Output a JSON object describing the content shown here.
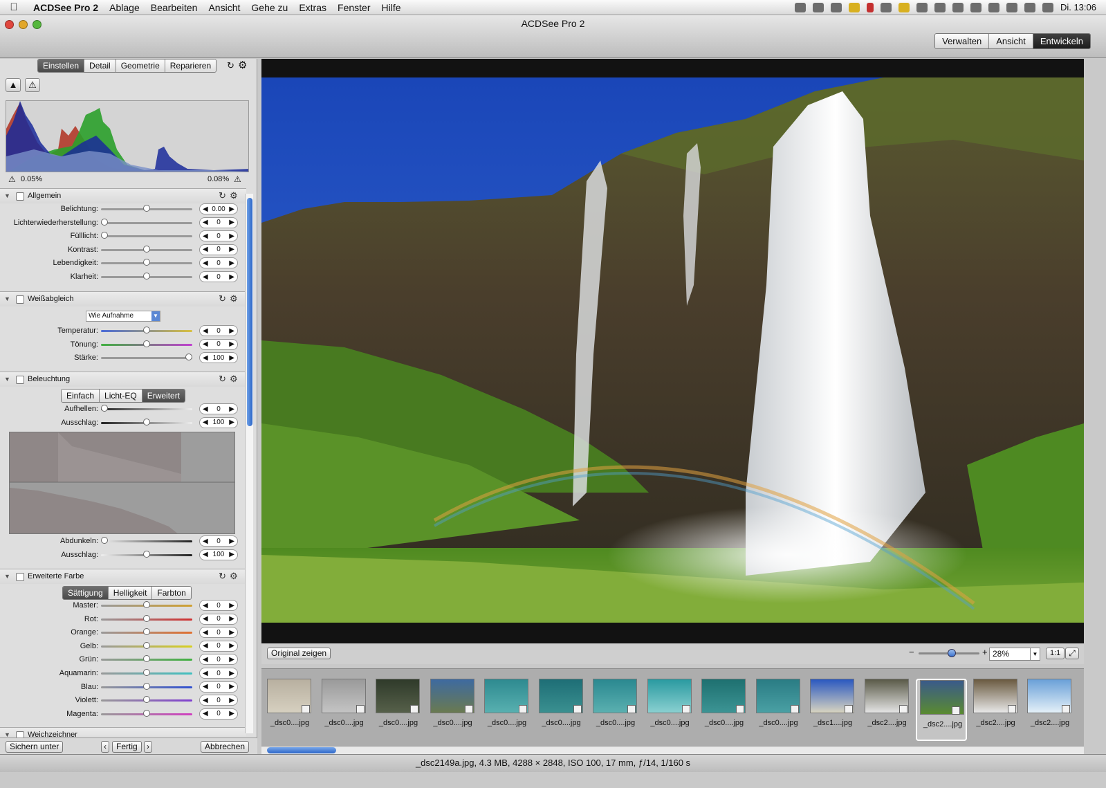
{
  "menubar": {
    "app_name": "ACDSee Pro 2",
    "items": [
      "Ablage",
      "Bearbeiten",
      "Ansicht",
      "Gehe zu",
      "Extras",
      "Fenster",
      "Hilfe"
    ],
    "clock": "Di. 13:06"
  },
  "window": {
    "title": "ACDSee Pro 2",
    "modes": [
      "Verwalten",
      "Ansicht",
      "Entwickeln"
    ],
    "active_mode": "Entwickeln"
  },
  "left_panel": {
    "tabs": [
      "Einstellen",
      "Detail",
      "Geometrie",
      "Reparieren"
    ],
    "active_tab": "Einstellen",
    "histogram": {
      "clip_low": "0.05%",
      "clip_high": "0.08%"
    },
    "allgemein": {
      "title": "Allgemein",
      "rows": [
        {
          "label": "Belichtung:",
          "value": "0.00",
          "level": 0.5
        },
        {
          "label": "Lichterwiederherstellung:",
          "value": "0",
          "level": 0
        },
        {
          "label": "Fülllicht:",
          "value": "0",
          "level": 0
        },
        {
          "label": "Kontrast:",
          "value": "0",
          "level": 0.5
        },
        {
          "label": "Lebendigkeit:",
          "value": "0",
          "level": 0.5
        },
        {
          "label": "Klarheit:",
          "value": "0",
          "level": 0.5
        }
      ]
    },
    "weissabgleich": {
      "title": "Weißabgleich",
      "preset": "Wie Aufnahme",
      "rows": [
        {
          "label": "Temperatur:",
          "value": "0",
          "level": 0.5
        },
        {
          "label": "Tönung:",
          "value": "0",
          "level": 0.5
        },
        {
          "label": "Stärke:",
          "value": "100",
          "level": 1
        }
      ]
    },
    "beleuchtung": {
      "title": "Beleuchtung",
      "tabs": [
        "Einfach",
        "Licht-EQ",
        "Erweitert"
      ],
      "active_tab": "Erweitert",
      "rows_top": [
        {
          "label": "Aufhellen:",
          "value": "0",
          "level": 0
        },
        {
          "label": "Ausschlag:",
          "value": "100",
          "level": 0.5
        }
      ],
      "rows_bottom": [
        {
          "label": "Abdunkeln:",
          "value": "0",
          "level": 0
        },
        {
          "label": "Ausschlag:",
          "value": "100",
          "level": 0.5
        }
      ]
    },
    "erweiterte_farbe": {
      "title": "Erweiterte Farbe",
      "tabs": [
        "Sättigung",
        "Helligkeit",
        "Farbton"
      ],
      "active_tab": "Sättigung",
      "rows": [
        {
          "label": "Master:",
          "value": "0",
          "level": 0.5,
          "color": "#d0a030"
        },
        {
          "label": "Rot:",
          "value": "0",
          "level": 0.5,
          "color": "#d03030"
        },
        {
          "label": "Orange:",
          "value": "0",
          "level": 0.5,
          "color": "#e07030"
        },
        {
          "label": "Gelb:",
          "value": "0",
          "level": 0.5,
          "color": "#d8d020"
        },
        {
          "label": "Grün:",
          "value": "0",
          "level": 0.5,
          "color": "#40b040"
        },
        {
          "label": "Aquamarin:",
          "value": "0",
          "level": 0.5,
          "color": "#40c0c0"
        },
        {
          "label": "Blau:",
          "value": "0",
          "level": 0.5,
          "color": "#3050d0"
        },
        {
          "label": "Violett:",
          "value": "0",
          "level": 0.5,
          "color": "#8040d0"
        },
        {
          "label": "Magenta:",
          "value": "0",
          "level": 0.5,
          "color": "#d040c0"
        }
      ]
    },
    "next_section": "Weichzeichner",
    "buttons": {
      "save_as": "Sichern unter",
      "done": "Fertig",
      "cancel": "Abbrechen"
    }
  },
  "viewer": {
    "show_original": "Original zeigen",
    "zoom": "28%",
    "one_to_one": "1:1",
    "zoom_level": 0.55
  },
  "filmstrip": [
    {
      "caption": "_dsc0....jpg",
      "c1": "#b8b0a0",
      "c2": "#d6d0c0"
    },
    {
      "caption": "_dsc0....jpg",
      "c1": "#9a9a9a",
      "c2": "#c4c4c4"
    },
    {
      "caption": "_dsc0....jpg",
      "c1": "#2f3a2a",
      "c2": "#56604a"
    },
    {
      "caption": "_dsc0....jpg",
      "c1": "#3e6aa0",
      "c2": "#6a7a50"
    },
    {
      "caption": "_dsc0....jpg",
      "c1": "#2e8a90",
      "c2": "#58b0b0"
    },
    {
      "caption": "_dsc0....jpg",
      "c1": "#1e6e76",
      "c2": "#3a9090"
    },
    {
      "caption": "_dsc0....jpg",
      "c1": "#2a8890",
      "c2": "#5ab0b0"
    },
    {
      "caption": "_dsc0....jpg",
      "c1": "#2a9aa0",
      "c2": "#8ad0d0"
    },
    {
      "caption": "_dsc0....jpg",
      "c1": "#1e7070",
      "c2": "#3c9494"
    },
    {
      "caption": "_dsc0....jpg",
      "c1": "#2a7c84",
      "c2": "#4aa0a4"
    },
    {
      "caption": "_dsc1....jpg",
      "c1": "#2a58c0",
      "c2": "#d8d4c0"
    },
    {
      "caption": "_dsc2....jpg",
      "c1": "#5a5a48",
      "c2": "#e4e4e4"
    },
    {
      "caption": "_dsc2....jpg",
      "c1": "#3a5a8a",
      "c2": "#5a8a30",
      "selected": true
    },
    {
      "caption": "_dsc2....jpg",
      "c1": "#6a5a40",
      "c2": "#e8e8e8"
    },
    {
      "caption": "_dsc2....jpg",
      "c1": "#6aa0d8",
      "c2": "#e4f0f8"
    }
  ],
  "status": "_dsc2149a.jpg, 4.3 MB, 4288 × 2848, ISO 100, 17 mm, ƒ/14, 1/160 s"
}
